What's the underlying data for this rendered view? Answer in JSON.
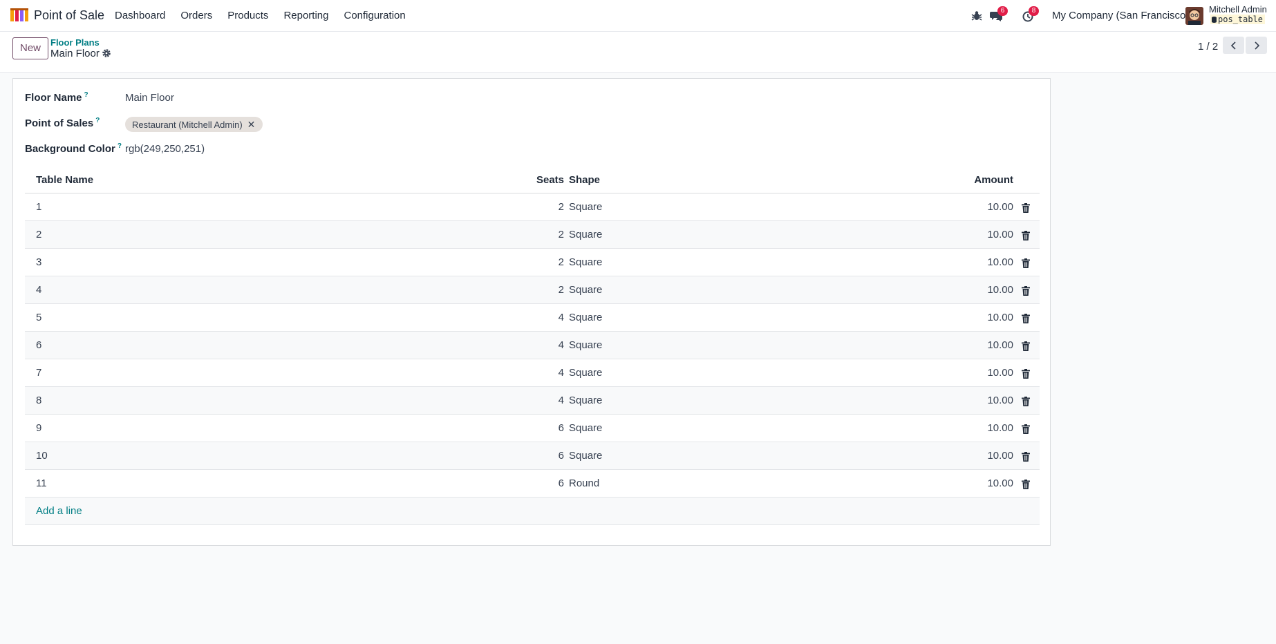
{
  "app": {
    "name": "Point of Sale",
    "menu": [
      "Dashboard",
      "Orders",
      "Products",
      "Reporting",
      "Configuration"
    ]
  },
  "systray": {
    "messages_count": "6",
    "activities_count": "8",
    "company": "My Company (San Francisco)",
    "user_name": "Mitchell Admin",
    "database": "pos_table"
  },
  "control_panel": {
    "new_label": "New",
    "breadcrumb": "Floor Plans",
    "record_title": "Main Floor",
    "pager": "1 / 2"
  },
  "form": {
    "floor_name_label": "Floor Name",
    "floor_name_value": "Main Floor",
    "pos_label": "Point of Sales",
    "pos_tag": "Restaurant (Mitchell Admin)",
    "bg_color_label": "Background Color",
    "bg_color_value": "rgb(249,250,251)",
    "help_mark": "?"
  },
  "table": {
    "headers": {
      "name": "Table Name",
      "seats": "Seats",
      "shape": "Shape",
      "amount": "Amount"
    },
    "rows": [
      {
        "name": "1",
        "seats": "2",
        "shape": "Square",
        "amount": "10.00"
      },
      {
        "name": "2",
        "seats": "2",
        "shape": "Square",
        "amount": "10.00"
      },
      {
        "name": "3",
        "seats": "2",
        "shape": "Square",
        "amount": "10.00"
      },
      {
        "name": "4",
        "seats": "2",
        "shape": "Square",
        "amount": "10.00"
      },
      {
        "name": "5",
        "seats": "4",
        "shape": "Square",
        "amount": "10.00"
      },
      {
        "name": "6",
        "seats": "4",
        "shape": "Square",
        "amount": "10.00"
      },
      {
        "name": "7",
        "seats": "4",
        "shape": "Square",
        "amount": "10.00"
      },
      {
        "name": "8",
        "seats": "4",
        "shape": "Square",
        "amount": "10.00"
      },
      {
        "name": "9",
        "seats": "6",
        "shape": "Square",
        "amount": "10.00"
      },
      {
        "name": "10",
        "seats": "6",
        "shape": "Square",
        "amount": "10.00"
      },
      {
        "name": "11",
        "seats": "6",
        "shape": "Round",
        "amount": "10.00"
      }
    ],
    "add_line": "Add a line"
  },
  "colors": {
    "brand": "#714b67",
    "link": "#017e84",
    "badge": "#e11d48"
  }
}
